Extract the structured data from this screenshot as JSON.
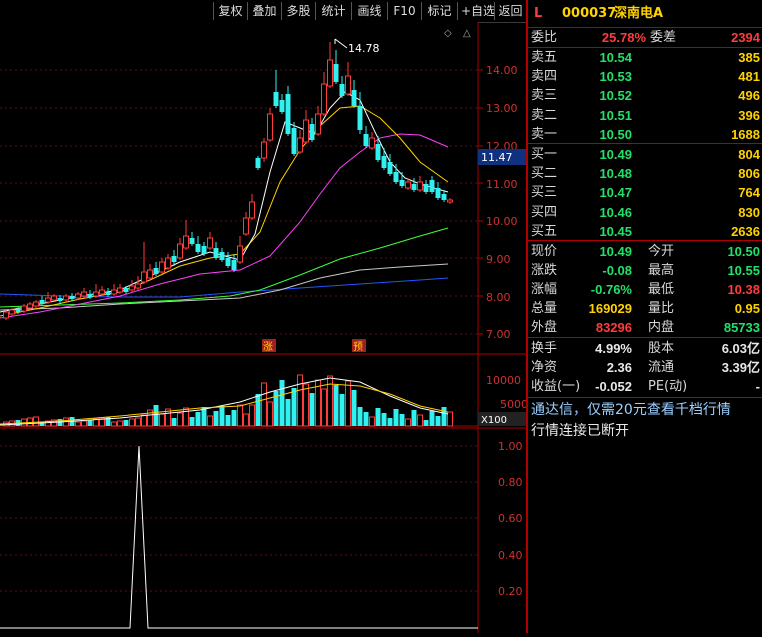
{
  "toolbar": {
    "buttons": [
      "复权",
      "叠加",
      "多股",
      "统计",
      "画线",
      "F10",
      "标记",
      "+自选",
      "返回"
    ]
  },
  "main_chart": {
    "max_marker": "14.78",
    "price_axis": [
      "14.00",
      "13.00",
      "12.00",
      "11.00",
      "10.00",
      "9.00",
      "8.00",
      "7.00"
    ],
    "current_price_tag": "11.47",
    "event_markers": [
      "涨",
      "预"
    ]
  },
  "volume_panel": {
    "axis": [
      "10000",
      "5000"
    ],
    "unit": "X100"
  },
  "indicator_panel": {
    "axis": [
      "1.00",
      "0.80",
      "0.60",
      "0.40",
      "0.20"
    ]
  },
  "quote": {
    "header": {
      "flag": "L",
      "code": "000037",
      "name": "深南电A"
    },
    "ratio": {
      "label": "委比",
      "value": "25.78%",
      "label2": "委差",
      "value2": "2394"
    },
    "asks": [
      {
        "label": "卖五",
        "price": "10.54",
        "vol": "385"
      },
      {
        "label": "卖四",
        "price": "10.53",
        "vol": "481"
      },
      {
        "label": "卖三",
        "price": "10.52",
        "vol": "496"
      },
      {
        "label": "卖二",
        "price": "10.51",
        "vol": "396"
      },
      {
        "label": "卖一",
        "price": "10.50",
        "vol": "1688"
      }
    ],
    "bids": [
      {
        "label": "买一",
        "price": "10.49",
        "vol": "804"
      },
      {
        "label": "买二",
        "price": "10.48",
        "vol": "806"
      },
      {
        "label": "买三",
        "price": "10.47",
        "vol": "764"
      },
      {
        "label": "买四",
        "price": "10.46",
        "vol": "830"
      },
      {
        "label": "买五",
        "price": "10.45",
        "vol": "2636"
      }
    ],
    "stats1": [
      {
        "l1": "现价",
        "v1": "10.49",
        "l2": "今开",
        "v2": "10.50"
      },
      {
        "l1": "涨跌",
        "v1": "-0.08",
        "l2": "最高",
        "v2": "10.55"
      },
      {
        "l1": "涨幅",
        "v1": "-0.76%",
        "l2": "最低",
        "v2": "10.38"
      },
      {
        "l1": "总量",
        "v1": "169029",
        "l2": "量比",
        "v2": "0.95"
      },
      {
        "l1": "外盘",
        "v1": "83296",
        "l2": "内盘",
        "v2": "85733"
      }
    ],
    "stats2": [
      {
        "l1": "换手",
        "v1": "4.99%",
        "l2": "股本",
        "v2": "6.03亿"
      },
      {
        "l1": "净资",
        "v1": "2.36",
        "l2": "流通",
        "v2": "3.39亿"
      },
      {
        "l1": "收益(一)",
        "v1": "-0.052",
        "l2": "PE(动)",
        "v2": "-"
      }
    ],
    "notice": "通达信，仅需20元查看千档行情",
    "status": "行情连接已断开"
  },
  "colors": {
    "up": "#ff3b3b",
    "down": "#30f0f0",
    "ma5": "#ffffff",
    "ma10": "#ffd200",
    "ma20": "#ff40ff",
    "ma60": "#3cff3c",
    "ma120": "#c8c8c8",
    "ma250": "#2255ff"
  }
}
